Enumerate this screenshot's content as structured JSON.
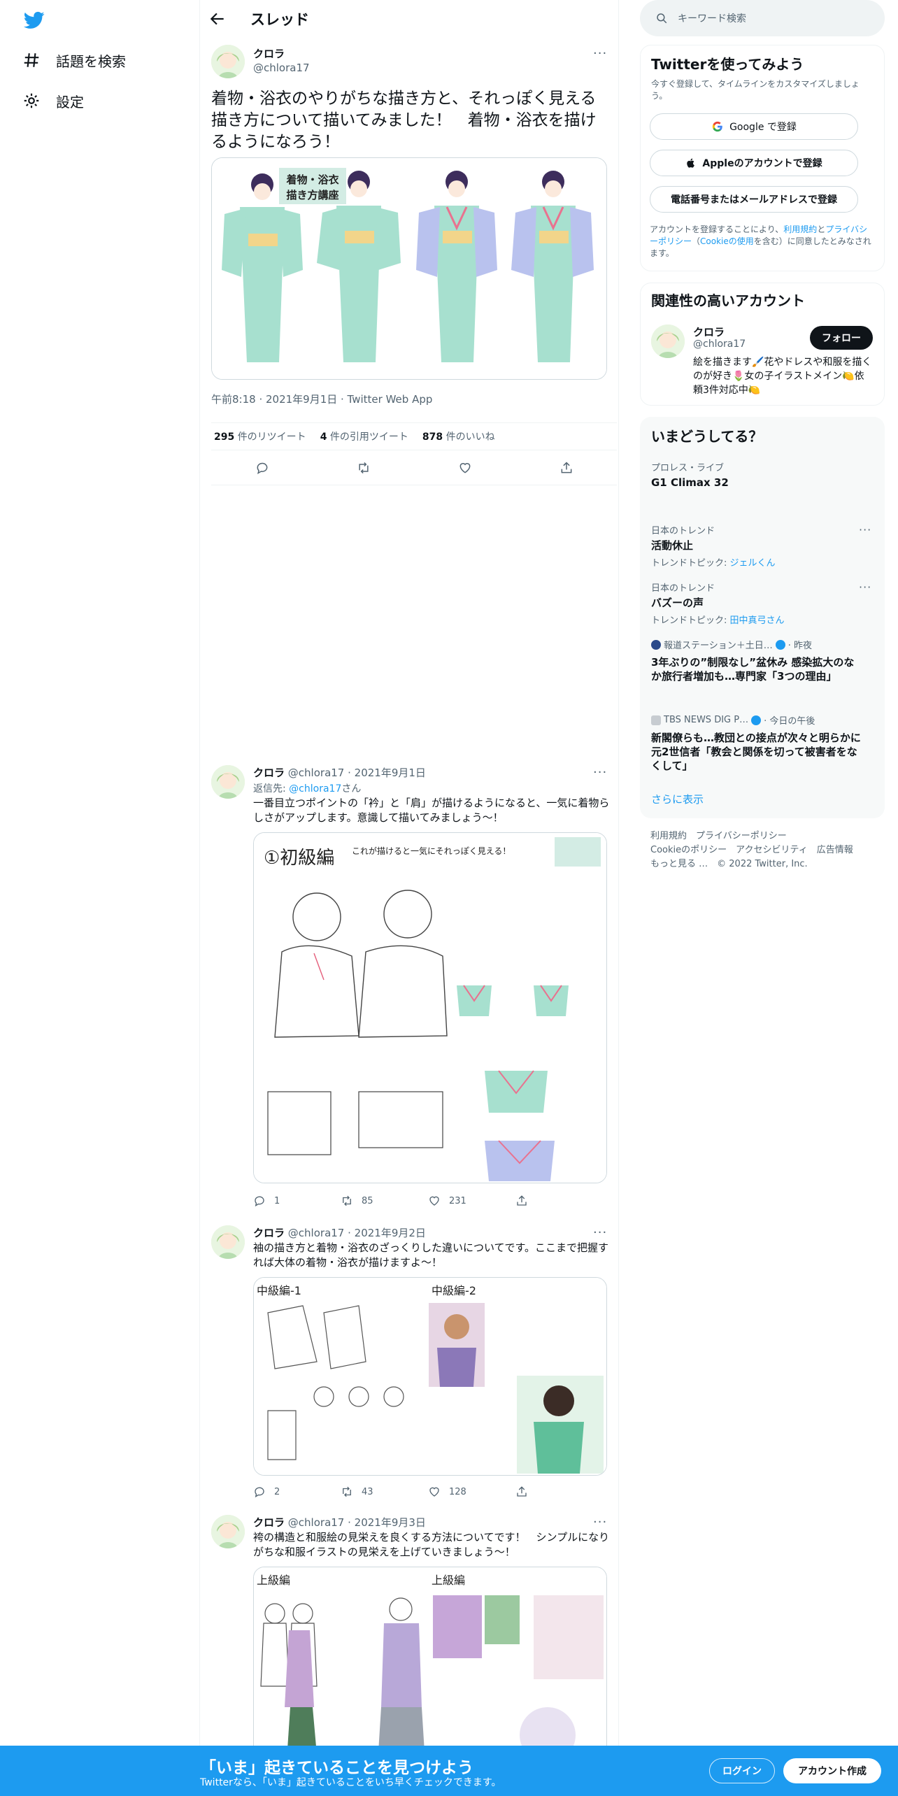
{
  "nav": {
    "explore": "話題を検索",
    "settings": "設定"
  },
  "header": {
    "title": "スレッド"
  },
  "main_tweet": {
    "name": "クロラ",
    "handle": "@chlora17",
    "more": "···",
    "text": "着物・浴衣のやりがちな描き方と、それっぽく見える描き方について描いてみました！　着物・浴衣を描けるようになろう！",
    "image_title": "着物・浴衣\n描き方講座",
    "meta": "午前8:18 · 2021年9月1日 · Twitter Web App",
    "stats": {
      "retweets_num": "295",
      "retweets_label": "件のリツイート",
      "quotes_num": "4",
      "quotes_label": "件の引用ツイート",
      "likes_num": "878",
      "likes_label": "件のいいね"
    }
  },
  "replies": [
    {
      "name": "クロラ",
      "handle": "@chlora17",
      "date": "· 2021年9月1日",
      "reply_to_label": "返信先:",
      "reply_to_handle": "@chlora17",
      "reply_to_suffix": "さん",
      "text": "一番目立つポイントの「衿」と「肩」が描けるようになると、一気に着物らしさがアップします。意識して描いてみましょう～！",
      "image_heading": "①初級編",
      "image_caption": "これが描けると一気にそれっぽく見える！",
      "replies": "1",
      "retweets": "85",
      "likes": "231"
    },
    {
      "name": "クロラ",
      "handle": "@chlora17",
      "date": "· 2021年9月2日",
      "text": "袖の描き方と着物・浴衣のざっくりした違いについてです。ここまで把握すれば大体の着物・浴衣が描けますよ～！",
      "image_heading_left": "中級編-1",
      "image_heading_right": "中級編-2",
      "replies": "2",
      "retweets": "43",
      "likes": "128"
    },
    {
      "name": "クロラ",
      "handle": "@chlora17",
      "date": "· 2021年9月3日",
      "text": "袴の構造と和服絵の見栄えを良くする方法についてです！　シンプルになりがちな和服イラストの見栄えを上げていきましょう～！",
      "image_heading_left": "上級編",
      "image_heading_right": "上級編"
    }
  ],
  "search": {
    "placeholder": "キーワード検索"
  },
  "signup_panel": {
    "title": "Twitterを使ってみよう",
    "subtitle": "今すぐ登録して、タイムラインをカスタマイズしましょう。",
    "google": "Google で登録",
    "apple": "Appleのアカウントで登録",
    "phone": "電話番号またはメールアドレスで登録",
    "fine_prefix": "アカウントを登録することにより、",
    "terms": "利用規約",
    "fine_and": "と",
    "privacy": "プライバシーポリシー",
    "fine_paren_open": "（",
    "cookie": "Cookieの使用",
    "fine_suffix": "を含む）に同意したとみなされます。"
  },
  "related_panel": {
    "title": "関連性の高いアカウント",
    "name": "クロラ",
    "handle": "@chlora17",
    "follow": "フォロー",
    "bio": "絵を描きます🖌️花やドレスや和服を描くのが好き🌷女の子イラストメイン🍋依頼3件対応中🍋"
  },
  "trends_panel": {
    "title": "いまどうしてる？",
    "items": [
      {
        "category": "プロレス・ライブ",
        "name": "G1 Climax 32"
      },
      {
        "category": "日本のトレンド",
        "name": "活動休止",
        "topic_label": "トレンドトピック:",
        "topic": "ジェルくん"
      },
      {
        "category": "日本のトレンド",
        "name": "バズーの声",
        "topic_label": "トレンドトピック:",
        "topic": "田中真弓さん"
      }
    ],
    "news": [
      {
        "source": "報道ステーション＋土日…",
        "time": "· 昨夜",
        "title": "3年ぶりの”制限なし”盆休み 感染拡大のなか旅行者増加も…専門家「3つの理由」"
      },
      {
        "source": "TBS NEWS DIG P…",
        "time": "· 今日の午後",
        "title": "新閣僚らも…教団との接点が次々と明らかに　元2世信者「教会と関係を切って被害者をなくして」"
      }
    ],
    "show_more": "さらに表示",
    "more": "···"
  },
  "footer": {
    "line1a": "利用規約",
    "line1b": "プライバシーポリシー",
    "line2a": "Cookieのポリシー",
    "line2b": "アクセシビリティ",
    "line2c": "広告情報",
    "line3a": "もっと見る …",
    "line3b": "© 2022 Twitter, Inc."
  },
  "bottom_bar": {
    "title": "「いま」起きていることを見つけよう",
    "subtitle": "Twitterなら、「いま」起きていることをいち早くチェックできます。",
    "login": "ログイン",
    "signup": "アカウント作成"
  },
  "colors": {
    "accent": "#1d9bf0",
    "text": "#0f1419",
    "muted": "#536471"
  }
}
